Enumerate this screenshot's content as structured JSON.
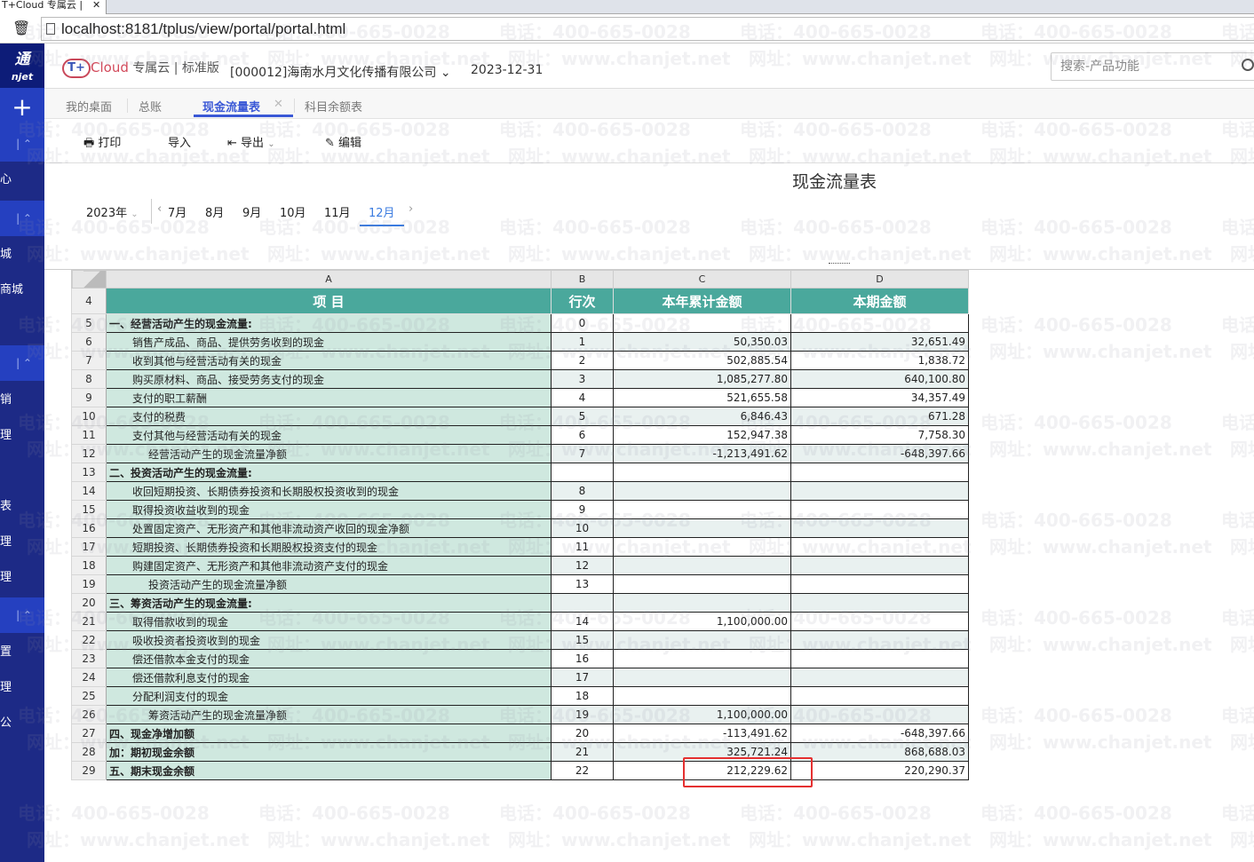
{
  "browser": {
    "tab_title": "T+Cloud 专属云 |",
    "url": "localhost:8181/tplus/view/portal/portal.html"
  },
  "sidebar": {
    "logo": "通",
    "logo_sub": "njet",
    "items": [
      "心",
      "城",
      "商城",
      "销",
      "理",
      "表",
      "理",
      "理",
      "置",
      "理",
      "公"
    ]
  },
  "header": {
    "brand_cloud": "Cloud",
    "brand_edition": "专属云 | 标准版",
    "company": "[000012]海南水月文化传播有限公司",
    "date": "2023-12-31",
    "search_placeholder": "搜索-产品功能"
  },
  "tabs": [
    {
      "label": "我的桌面"
    },
    {
      "label": "总账"
    },
    {
      "label": "现金流量表",
      "active": true
    },
    {
      "label": "科目余额表"
    }
  ],
  "toolbar": {
    "print": "打印",
    "import": "导入",
    "export": "导出",
    "edit": "编辑"
  },
  "report": {
    "title": "现金流量表",
    "year": "2023年",
    "months": [
      "7月",
      "8月",
      "9月",
      "10月",
      "11月",
      "12月"
    ],
    "active_month": "12月"
  },
  "sheet": {
    "columns": [
      "A",
      "B",
      "C",
      "D"
    ],
    "header_row": 4,
    "headers": [
      "项 目",
      "行次",
      "本年累计金额",
      "本期金额"
    ],
    "rows": [
      {
        "r": 5,
        "item": "一、经营活动产生的现金流量:",
        "line": "0",
        "ytd": "",
        "cur": "",
        "bold": true,
        "indent": 0
      },
      {
        "r": 6,
        "item": "销售产成品、商品、提供劳务收到的现金",
        "line": "1",
        "ytd": "50,350.03",
        "cur": "32,651.49",
        "indent": 1
      },
      {
        "r": 7,
        "item": "收到其他与经营活动有关的现金",
        "line": "2",
        "ytd": "502,885.54",
        "cur": "1,838.72",
        "indent": 1
      },
      {
        "r": 8,
        "item": "购买原材料、商品、接受劳务支付的现金",
        "line": "3",
        "ytd": "1,085,277.80",
        "cur": "640,100.80",
        "indent": 1
      },
      {
        "r": 9,
        "item": "支付的职工薪酬",
        "line": "4",
        "ytd": "521,655.58",
        "cur": "34,357.49",
        "indent": 1
      },
      {
        "r": 10,
        "item": "支付的税费",
        "line": "5",
        "ytd": "6,846.43",
        "cur": "671.28",
        "indent": 1
      },
      {
        "r": 11,
        "item": "支付其他与经营活动有关的现金",
        "line": "6",
        "ytd": "152,947.38",
        "cur": "7,758.30",
        "indent": 1
      },
      {
        "r": 12,
        "item": "经营活动产生的现金流量净额",
        "line": "7",
        "ytd": "-1,213,491.62",
        "cur": "-648,397.66",
        "indent": 2
      },
      {
        "r": 13,
        "item": "二、投资活动产生的现金流量:",
        "line": "",
        "ytd": "",
        "cur": "",
        "bold": true,
        "indent": 0
      },
      {
        "r": 14,
        "item": "收回短期投资、长期债券投资和长期股权投资收到的现金",
        "line": "8",
        "ytd": "",
        "cur": "",
        "indent": 1
      },
      {
        "r": 15,
        "item": "取得投资收益收到的现金",
        "line": "9",
        "ytd": "",
        "cur": "",
        "indent": 1
      },
      {
        "r": 16,
        "item": "处置固定资产、无形资产和其他非流动资产收回的现金净额",
        "line": "10",
        "ytd": "",
        "cur": "",
        "indent": 1
      },
      {
        "r": 17,
        "item": "短期投资、长期债券投资和长期股权投资支付的现金",
        "line": "11",
        "ytd": "",
        "cur": "",
        "indent": 1
      },
      {
        "r": 18,
        "item": "购建固定资产、无形资产和其他非流动资产支付的现金",
        "line": "12",
        "ytd": "",
        "cur": "",
        "indent": 1
      },
      {
        "r": 19,
        "item": "投资活动产生的现金流量净额",
        "line": "13",
        "ytd": "",
        "cur": "",
        "indent": 2
      },
      {
        "r": 20,
        "item": "三、筹资活动产生的现金流量:",
        "line": "",
        "ytd": "",
        "cur": "",
        "bold": true,
        "indent": 0
      },
      {
        "r": 21,
        "item": "取得借款收到的现金",
        "line": "14",
        "ytd": "1,100,000.00",
        "cur": "",
        "indent": 1
      },
      {
        "r": 22,
        "item": "吸收投资者投资收到的现金",
        "line": "15",
        "ytd": "",
        "cur": "",
        "indent": 1
      },
      {
        "r": 23,
        "item": "偿还借款本金支付的现金",
        "line": "16",
        "ytd": "",
        "cur": "",
        "indent": 1
      },
      {
        "r": 24,
        "item": "偿还借款利息支付的现金",
        "line": "17",
        "ytd": "",
        "cur": "",
        "indent": 1
      },
      {
        "r": 25,
        "item": "分配利润支付的现金",
        "line": "18",
        "ytd": "",
        "cur": "",
        "indent": 1
      },
      {
        "r": 26,
        "item": "筹资活动产生的现金流量净额",
        "line": "19",
        "ytd": "1,100,000.00",
        "cur": "",
        "indent": 2
      },
      {
        "r": 27,
        "item": "四、现金净增加额",
        "line": "20",
        "ytd": "-113,491.62",
        "cur": "-648,397.66",
        "bold": true,
        "indent": 0
      },
      {
        "r": 28,
        "item": "加：期初现金余额",
        "line": "21",
        "ytd": "325,721.24",
        "cur": "868,688.03",
        "bold": true,
        "indent": 0
      },
      {
        "r": 29,
        "item": "五、期末现金余额",
        "line": "22",
        "ytd": "212,229.62",
        "cur": "220,290.37",
        "bold": true,
        "indent": 0
      }
    ]
  },
  "watermark": {
    "phone": "电话：400-665-0028",
    "web": "网址：www.chanjet.net"
  },
  "colors": {
    "sidebar": "#1d2a86",
    "accent": "#3a58d6",
    "header_fill": "#4aa89c",
    "item_fill": "#cfe8df",
    "highlight": "#e53030"
  }
}
